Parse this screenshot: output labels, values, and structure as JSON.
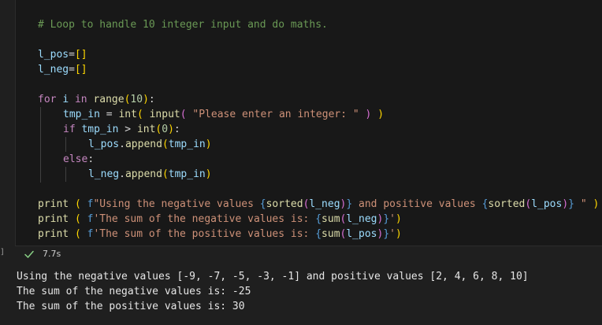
{
  "code": {
    "comment": "# Loop to handle 10 integer input and do maths.",
    "lpos": "l_pos",
    "lneg": "l_neg",
    "eq": "=",
    "empty_list": "[]",
    "kw_for": "for",
    "var_i": "i",
    "kw_in": "in",
    "fn_range": "range",
    "paren_open": "(",
    "paren_close": ")",
    "num_10": "10",
    "colon": ":",
    "tmp_in": "tmp_in",
    "fn_int": "int",
    "fn_input": "input",
    "prompt": "\"Please enter an integer: \"",
    "kw_if": "if",
    "gt": ">",
    "num_0": "0",
    "dot": ".",
    "fn_append": "append",
    "kw_else": "else",
    "fn_print": "print",
    "f_prefix": "f",
    "fs1_a": "\"Using the negative values ",
    "brace_open": "{",
    "brace_close": "}",
    "fn_sorted": "sorted",
    "fs1_b": " and positive values ",
    "fs1_c": " \"",
    "fs2_a": "'The sum of the negative values is: ",
    "fn_sum": "sum",
    "quote_close": "'",
    "fs3_a": "'The sum of the positive values is: "
  },
  "status": {
    "marker": "]",
    "check_icon": "check-icon",
    "time": "7.7s",
    "success_color": "#89d185"
  },
  "output": {
    "lines": [
      "Using the negative values [-9, -7, -5, -3, -1] and positive values [2, 4, 6, 8, 10]",
      "The sum of the negative values is: -25",
      "The sum of the positive values is: 30"
    ]
  }
}
